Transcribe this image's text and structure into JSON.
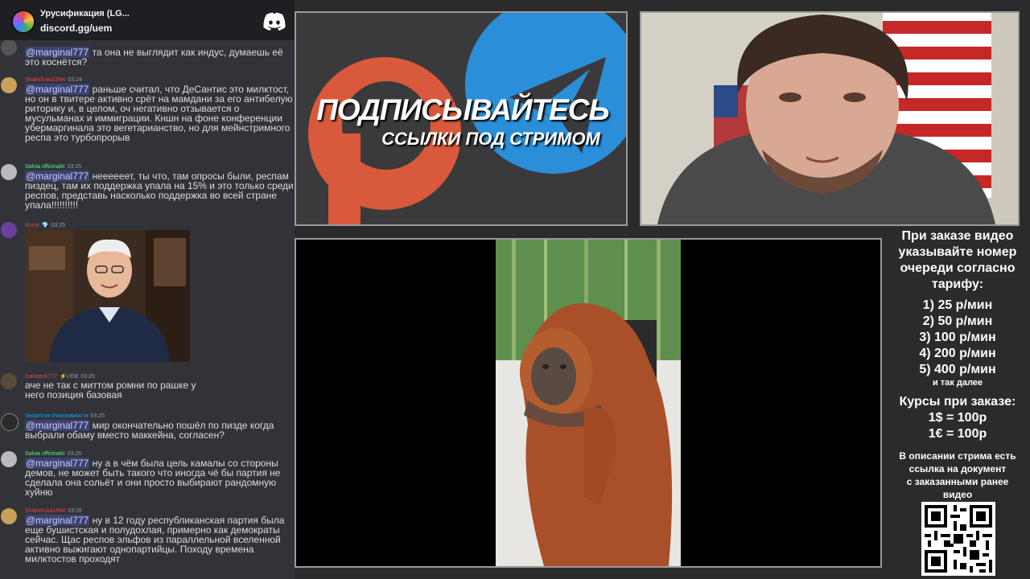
{
  "colors": {
    "chat_bg": "#313338",
    "header_bg": "#1e1f22",
    "mention_bg": "#3c4270",
    "mention_fg": "#c9cdfb"
  },
  "header": {
    "server_name": "Урусификация (LG...",
    "invite": "discord.gg/uem",
    "logo_icon": "discord-icon"
  },
  "messages": [
    {
      "partial": true,
      "mention": "@marginal777",
      "text": "та она не выглядит как индус, думаешь её это коснётся?"
    },
    {
      "author": "Shakshuka1984",
      "author_color": "#ed4245",
      "time": "03:24",
      "mention": "@marginal777",
      "text": "раньше считал, что ДеСантис это милктост, но он в твитере активно срёт на мамдани за его антибелую риторику и, в целом, оч негативно отзывается о мусульманах и иммиграции. Кншн на фоне конференции убермаргинала это вегетарианство, но для мейнстримного респа это турбопрорыв"
    },
    {
      "author": "Salvia officinalis",
      "author_color": "#57f287",
      "time": "03:25",
      "mention": "@marginal777",
      "text": "неееееет, ты что, там опросы были, респам пиздец, там их поддержка упала на 15% и это только среди респов, представь насколько поддержка во всей стране упала!!!!!!!!!!"
    },
    {
      "author": "Rusty",
      "author_color": "#ed4245",
      "time": "03:25",
      "badge": "💎"
    },
    {
      "author": "Isaneech777",
      "author_color": "#ed4245",
      "time": "03:25",
      "badge": "⚡UEB",
      "text": "аче не так с миттом ромни по рашке у него позиция базовая"
    },
    {
      "author": "Vasantrue #чмозовиостя",
      "author_color": "#00a8fc",
      "time": "03:25",
      "mention": "@marginal777",
      "text": "мир окончательно пошёл по пизде когда выбрали обаму вместо маккейна, согласен?"
    },
    {
      "author": "Salvia officinalis",
      "author_color": "#57f287",
      "time": "03:26",
      "mention": "@marginal777",
      "text": "ну а в чём была цель камалы со стороны демов, не может быть такого что иногда чё бы партия не сделала она сольёт и они просто выбирают рандомную хуйню"
    },
    {
      "author": "Shakshuka1984",
      "author_color": "#ed4245",
      "time": "03:26",
      "mention": "@marginal777",
      "text": "ну в 12 году республиканская партия была еще бушистская и полудохлая, примерно как демократы сейчас. Щас респов эльфов из параллельной вселенной активно выжигают однопартийцы. Походу времена милктостов проходят"
    }
  ],
  "promo": {
    "title": "ПОДПИСЫВАЙТЕСЬ",
    "subtitle": "ССЫЛКИ ПОД СТРИМОМ"
  },
  "info": {
    "heading": [
      "При заказе видео",
      "указывайте номер",
      "очереди согласно",
      "тарифу:"
    ],
    "tariffs": [
      "1) 25 р/мин",
      "2) 50 р/мин",
      "3) 100 р/мин",
      "4) 200 р/мин",
      "5) 400 р/мин"
    ],
    "etc": "и так далее",
    "rates_title": "Курсы при заказе:",
    "rates": [
      "1$ = 100р",
      "1€ = 100р"
    ],
    "footer": [
      "В описании стрима есть",
      "ссылка на документ",
      "с заказанными ранее",
      "видео"
    ]
  }
}
